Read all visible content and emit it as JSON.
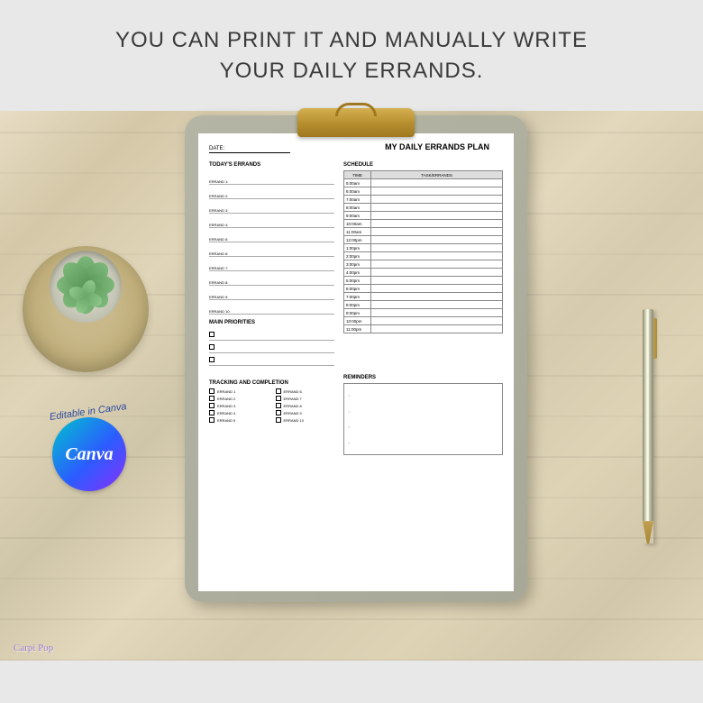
{
  "header": {
    "line1": "YOU CAN PRINT IT AND MANUALLY WRITE",
    "line2": "YOUR DAILY ERRANDS."
  },
  "badge": {
    "editable_text": "Editable in Canva",
    "logo_text": "Canva"
  },
  "paper": {
    "date_label": "DATE:",
    "title": "MY DAILY ERRANDS PLAN",
    "todays_errands_title": "TODAY'S ERRANDS",
    "errand_labels": [
      "ERRAND 1:",
      "ERRAND 2:",
      "ERRAND 3:",
      "ERRAND 4:",
      "ERRAND 5:",
      "ERRAND 6:",
      "ERRAND 7:",
      "ERRAND 8:",
      "ERRAND 9:",
      "ERRAND 10:"
    ],
    "main_priorities_title": "MAIN PRIORITIES",
    "priority_count": 3,
    "schedule_title": "SCHEDULE",
    "schedule_headers": {
      "time": "TIME",
      "task": "TASK/ERRANDS"
    },
    "schedule_times": [
      "5:00am",
      "6:00am",
      "7:00am",
      "8:00am",
      "9:00am",
      "10:00am",
      "11:00am",
      "12:00pm",
      "1:00pm",
      "2:00pm",
      "3:00pm",
      "4:00pm",
      "5:00pm",
      "6:00pm",
      "7:00pm",
      "8:00pm",
      "9:00pm",
      "10:00pm",
      "11:00pm"
    ],
    "tracking_title": "TRACKING AND COMPLETION",
    "tracking_items": [
      "ERRAND 1",
      "ERRAND 2",
      "ERRAND 3",
      "ERRAND 4",
      "ERRAND 5",
      "ERRAND 6",
      "ERRAND 7",
      "ERRAND 8",
      "ERRAND 9",
      "ERRAND 10"
    ],
    "reminders_title": "REMINDERS"
  },
  "watermark": "Carpi Pop"
}
